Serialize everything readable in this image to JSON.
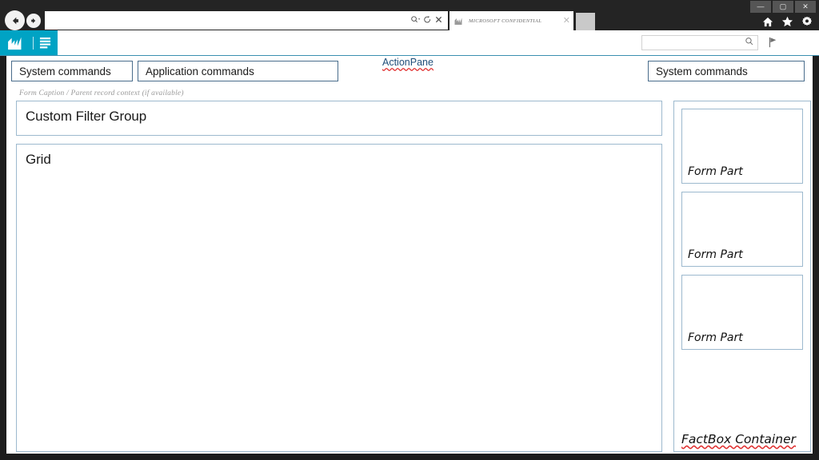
{
  "browser": {
    "address_value": "",
    "address_placeholder": "",
    "nav": {
      "back_icon": "back-arrow-icon",
      "forward_icon": "forward-arrow-icon"
    },
    "address_icons": {
      "search_caret": "⌕▾",
      "refresh": "↻",
      "stop": "✕"
    },
    "tab": {
      "title": "MICROSOFT CONFIDENTIAL",
      "favicon": "dynamics-logo-icon",
      "close": "✕"
    },
    "new_tab_label": "",
    "window_controls": {
      "minimize": "—",
      "maximize": "▢",
      "close": "✕"
    },
    "tools": {
      "home": "⌂",
      "favorites": "★",
      "settings": "⚙"
    }
  },
  "app_bar": {
    "logo_icon": "dynamics-logo-icon",
    "menu_icon": "list-menu-icon",
    "search_value": "",
    "search_placeholder": "",
    "search_icon": "magnifier-icon",
    "flag_icon": "flag-icon"
  },
  "action_pane": {
    "system_commands_left": "System commands",
    "application_commands": "Application commands",
    "system_commands_right": "System commands",
    "annotation": "ActionPane"
  },
  "form": {
    "caption": "Form Caption / Parent record context (if available)",
    "filter_group_title": "Custom Filter Group",
    "grid_title": "Grid"
  },
  "factbox": {
    "container_label": "FactBox Container",
    "parts": [
      {
        "label": "Form Part"
      },
      {
        "label": "Form Part"
      },
      {
        "label": "Form Part"
      }
    ]
  },
  "colors": {
    "accent_teal": "#00a3c4",
    "panel_border": "#9db9ce",
    "command_border": "#4a6d8c",
    "chrome_dark": "#242424",
    "spellcheck_red": "#e03030",
    "annotation_blue": "#1f4e79"
  }
}
